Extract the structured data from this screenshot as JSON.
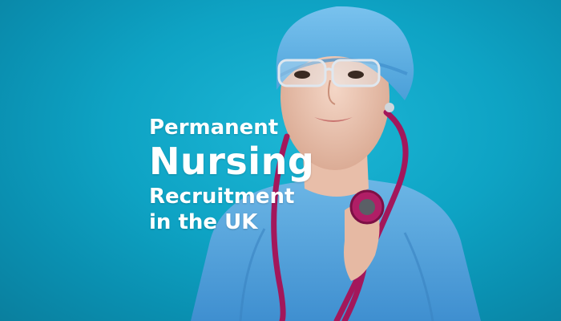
{
  "headline": {
    "line1": "Permanent",
    "line2": "Nursing",
    "line3": "Recruitment",
    "line4": "in the UK"
  },
  "colors": {
    "background": "#0ea3c4",
    "scrubs": "#5aa9dd",
    "stethoscope": "#a3175b",
    "text": "#ffffff"
  },
  "image": {
    "subject": "nurse-with-stethoscope"
  }
}
